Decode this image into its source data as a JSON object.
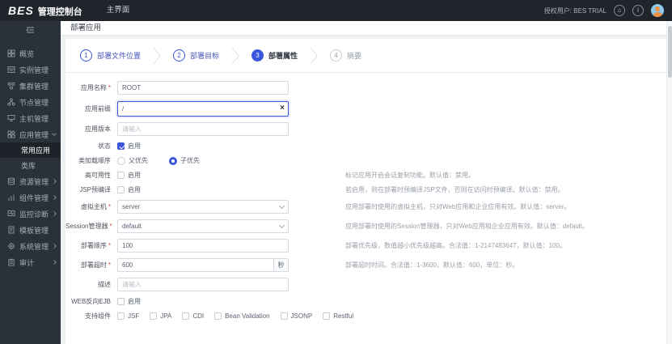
{
  "header": {
    "logo": "BES",
    "logo_text": "管理控制台",
    "menu_main": "主界面",
    "licensed_user": "授权用户: BES TRIAL",
    "info_glyph": "i"
  },
  "sidebar": {
    "items": [
      {
        "label": "概览",
        "icon": "dashboard-icon"
      },
      {
        "label": "实例管理",
        "icon": "instance-icon"
      },
      {
        "label": "集群管理",
        "icon": "cluster-icon"
      },
      {
        "label": "节点管理",
        "icon": "node-icon"
      },
      {
        "label": "主机管理",
        "icon": "host-icon"
      },
      {
        "label": "应用管理",
        "icon": "app-icon",
        "expanded": true
      },
      {
        "label": "资源管理",
        "icon": "resource-icon",
        "has_children": true
      },
      {
        "label": "组件管理",
        "icon": "component-icon",
        "has_children": true
      },
      {
        "label": "监控诊断",
        "icon": "monitor-icon",
        "has_children": true
      },
      {
        "label": "模板管理",
        "icon": "template-icon"
      },
      {
        "label": "系统管理",
        "icon": "system-icon",
        "has_children": true
      },
      {
        "label": "审计",
        "icon": "audit-icon",
        "has_children": true
      }
    ],
    "app_children": [
      {
        "label": "常用应用",
        "active": true
      },
      {
        "label": "类库",
        "active": false
      }
    ]
  },
  "page": {
    "title": "部署应用"
  },
  "wizard": {
    "steps": [
      {
        "num": "1",
        "label": "部署文件位置",
        "state": "done"
      },
      {
        "num": "2",
        "label": "部署目标",
        "state": "done"
      },
      {
        "num": "3",
        "label": "部署属性",
        "state": "active"
      },
      {
        "num": "4",
        "label": "摘要",
        "state": "pending"
      }
    ]
  },
  "form": {
    "required_mark": "*",
    "rows": [
      {
        "label": "应用名称",
        "required": true,
        "value": "ROOT"
      },
      {
        "label": "应用前缀",
        "value": "/",
        "focused": true,
        "clear_glyph": "×"
      },
      {
        "label": "应用版本",
        "placeholder": "请输入"
      },
      {
        "label": "状态",
        "checkbox": "启用",
        "checked": true
      },
      {
        "label": "类加载顺序",
        "options": [
          {
            "label": "父优先",
            "selected": false
          },
          {
            "label": "子优先",
            "selected": true
          }
        ]
      },
      {
        "label": "高可用性",
        "checkbox": "启用",
        "checked": false,
        "desc": "标记应用开启会话复制功能。默认值：禁用。"
      },
      {
        "label": "JSP预编译",
        "checkbox": "启用",
        "checked": false,
        "desc": "若启用，则在部署时预编译JSP文件，否则在访问时预编译。默认值：禁用。"
      },
      {
        "label": "虚拟主机",
        "required": true,
        "value": "server",
        "select": true,
        "desc": "应用部署时使用的虚拟主机，只对Web应用和企业应用有效。默认值：server。"
      },
      {
        "label": "Session管理器",
        "required": true,
        "value": "default",
        "select": true,
        "desc": "应用部署时使用的Session管理器，只对Web应用和企业应用有效。默认值：default。"
      },
      {
        "label": "部署顺序",
        "required": true,
        "value": "100",
        "desc": "部署优先级，数值越小优先级越高。合法值：1-2147483647，默认值：100。"
      },
      {
        "label": "部署超时",
        "required": true,
        "value": "600",
        "suffix": "秒",
        "desc": "部署超时时间。合法值：1-3600，默认值：600，单位：秒。"
      },
      {
        "label": "描述",
        "placeholder": "请输入"
      },
      {
        "label": "WEB反向EJB",
        "checkbox": "启用",
        "checked": false
      },
      {
        "label": "支持组件",
        "components": [
          "JSF",
          "JPA",
          "CDI",
          "Bean Validation",
          "JSONP",
          "Restful"
        ]
      }
    ]
  },
  "colors": {
    "accent": "#3a56dd",
    "header_bg": "#20252c",
    "sidebar_bg": "#2b313a",
    "sidebar_active_bg": "#1e232a",
    "required_red": "#e0483e",
    "desc_gray": "#9aa1ac"
  }
}
